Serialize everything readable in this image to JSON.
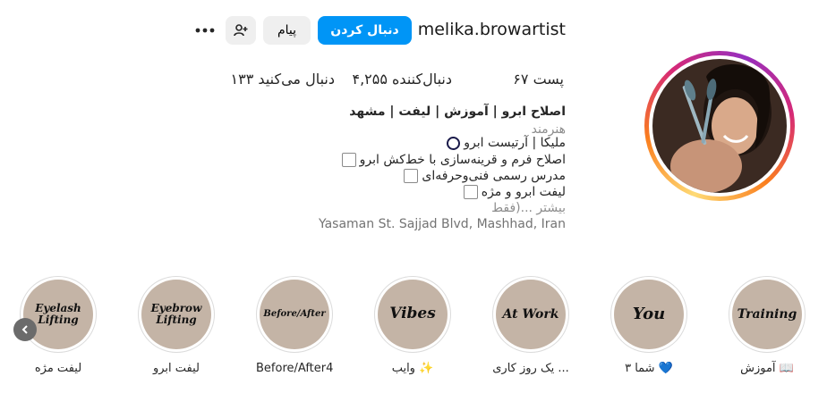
{
  "profile": {
    "username": "melika.browartist",
    "follow_label": "دنبال کردن",
    "message_label": "پیام",
    "add_user_icon": "person-add-icon",
    "more_icon": "more-options-icon"
  },
  "stats": {
    "posts": "۶۷ پست",
    "followers": "۴,۲۵۵ دنبال‌کننده",
    "following": "۱۳۳ دنبال می‌کنید"
  },
  "bio": {
    "name": "اصلاح ابرو | آموزش | لیفت | مشهد",
    "category": "هنرمند",
    "lines": [
      "ملیکا | آرتیست ابرو",
      "اصلاح فرم و قرینه‌سازی با خط‌کش ابرو",
      "مدرس رسمی فنی‌وحرفه‌ای",
      "لیفت ابرو و مژه"
    ],
    "more": "بیشتر ...(فقط",
    "address": "Yasaman St. Sajjad Blvd, Mashhad, Iran"
  },
  "highlights": [
    {
      "cover": "Training",
      "label": "آموزش 📖"
    },
    {
      "cover": "You",
      "label": "شما ۳ 💙"
    },
    {
      "cover": "At Work",
      "label": "یک روز کاری ..."
    },
    {
      "cover": "Vibes",
      "label": "وایب ✨"
    },
    {
      "cover": "Before/After",
      "label": "Before/After4"
    },
    {
      "cover": "Eyebrow Lifting",
      "label": "لیفت ابرو"
    },
    {
      "cover": "Eyelash Lifting",
      "label": "لیفت مژه"
    }
  ],
  "colors": {
    "follow_button": "#0095f6",
    "highlight_cover": "#c4b4a6",
    "story_ring": [
      "#feda75",
      "#fa7e1e",
      "#d62976",
      "#962fbf"
    ]
  },
  "nav": {
    "prev_icon": "chevron-left-icon"
  }
}
